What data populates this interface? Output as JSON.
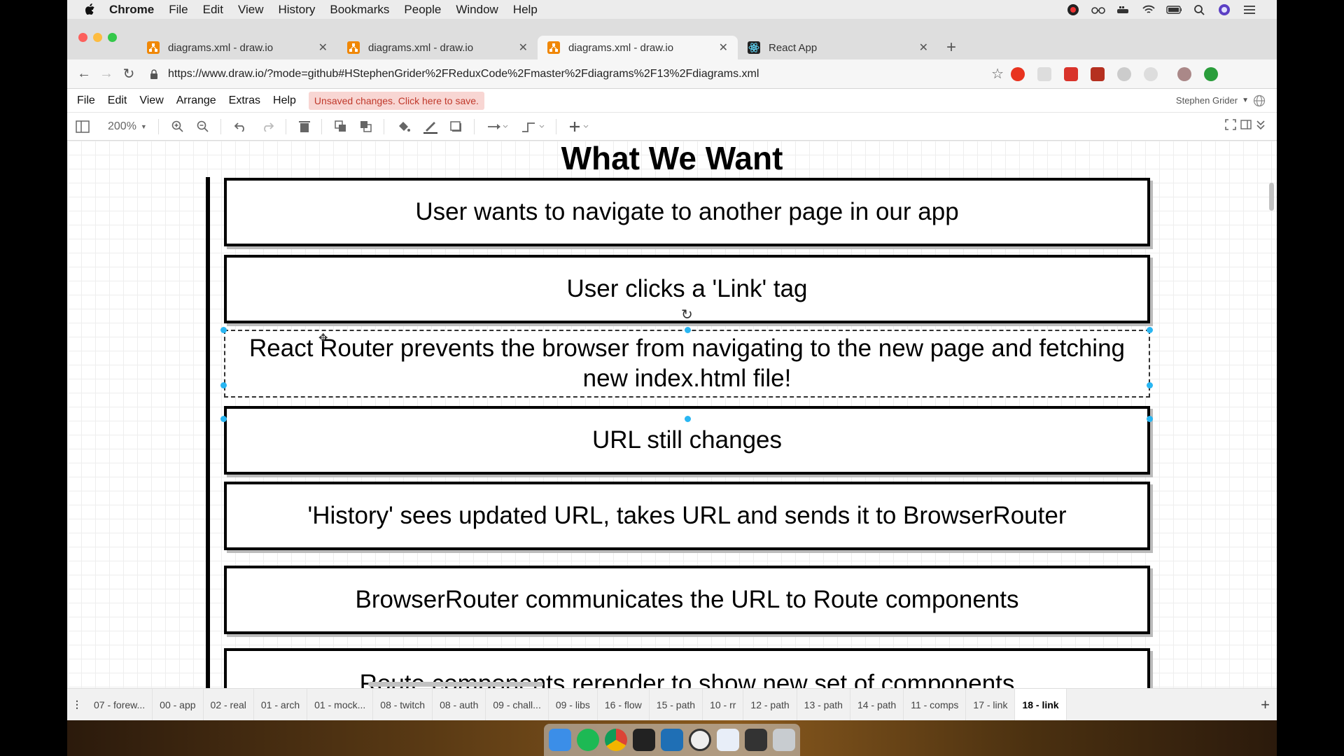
{
  "menubar": {
    "app_name": "Chrome",
    "items": [
      "File",
      "Edit",
      "View",
      "History",
      "Bookmarks",
      "People",
      "Window",
      "Help"
    ]
  },
  "tabs": [
    {
      "title": "diagrams.xml - draw.io",
      "icon": "drawio-icon",
      "active": false
    },
    {
      "title": "diagrams.xml - draw.io",
      "icon": "drawio-icon",
      "active": false
    },
    {
      "title": "diagrams.xml - draw.io",
      "icon": "drawio-icon",
      "active": true
    },
    {
      "title": "React App",
      "icon": "react-icon",
      "active": false
    }
  ],
  "address": {
    "url": "https://www.draw.io/?mode=github#HStephenGrider%2FReduxCode%2Fmaster%2Fdiagrams%2F13%2Fdiagrams.xml"
  },
  "drawio": {
    "menu": [
      "File",
      "Edit",
      "View",
      "Arrange",
      "Extras",
      "Help"
    ],
    "unsaved_notice": "Unsaved changes. Click here to save.",
    "user_name": "Stephen Grider",
    "zoom": "200%"
  },
  "diagram": {
    "title": "What We Want",
    "boxes": [
      "User wants to navigate to another page in our app",
      "User clicks a 'Link' tag",
      "React Router prevents the browser from navigating to the new page and fetching new index.html file!",
      "URL still changes",
      "'History' sees updated URL, takes URL and sends it to BrowserRouter",
      "BrowserRouter communicates the URL to Route components",
      "Route components rerender to show new set of components"
    ]
  },
  "pages": [
    "07 - forew...",
    "00 - app",
    "02 - real",
    "01 - arch",
    "01 - mock...",
    "08 - twitch",
    "08 - auth",
    "09 - chall...",
    "09 - libs",
    "16 - flow",
    "15 - path",
    "10 - rr",
    "12 - path",
    "13 - path",
    "14 - path",
    "11 - comps",
    "17 - link",
    "18 - link"
  ],
  "active_page": "18 - link",
  "colors": {
    "selection_handle": "#29b6f2",
    "unsaved_bg": "#f8d6d3",
    "unsaved_text": "#c0392b"
  }
}
